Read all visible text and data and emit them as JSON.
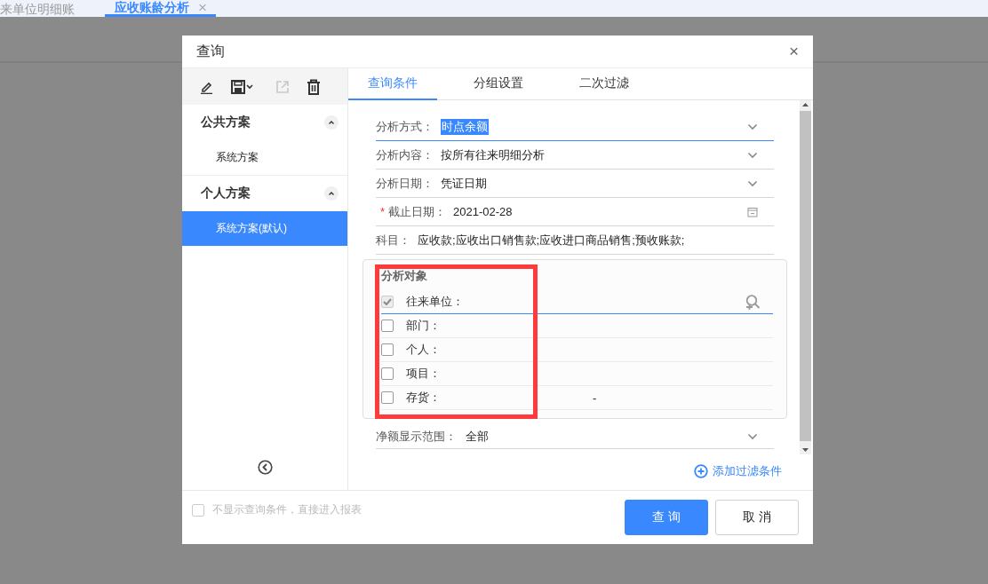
{
  "page_tabs": [
    {
      "label": "来单位明细账",
      "selected": false,
      "closable": false
    },
    {
      "label": "应收账龄分析",
      "selected": true,
      "closable": true,
      "close": "×"
    }
  ],
  "dialog": {
    "title": "查询",
    "close": "×"
  },
  "toolbar": [
    {
      "kind": "edit",
      "disabled": false
    },
    {
      "kind": "save",
      "disabled": false
    },
    {
      "kind": "export",
      "disabled": true
    },
    {
      "kind": "delete",
      "disabled": false
    }
  ],
  "scheme_groups": [
    {
      "title": "公共方案",
      "expanded": true,
      "items": [
        {
          "label": "系统方案",
          "selected": false
        }
      ]
    },
    {
      "title": "个人方案",
      "expanded": true,
      "items": [
        {
          "label": "系统方案(默认)",
          "selected": true
        }
      ]
    }
  ],
  "tabs": [
    {
      "label": "查询条件",
      "selected": true
    },
    {
      "label": "分组设置",
      "selected": false
    },
    {
      "label": "二次过滤",
      "selected": false
    }
  ],
  "fields": [
    {
      "kind": "select",
      "label": "分析方式：",
      "value": "时点余额",
      "required": false,
      "focused": true
    },
    {
      "kind": "select",
      "label": "分析内容：",
      "value": "按所有往来明细分析",
      "required": false,
      "focused": false
    },
    {
      "kind": "select",
      "label": "分析日期：",
      "value": "凭证日期",
      "required": false,
      "focused": false
    },
    {
      "kind": "date",
      "required_mark": "*",
      "label": "截止日期：",
      "value": "2021-02-28",
      "required": true,
      "focused": false
    },
    {
      "kind": "text",
      "label": "科目：",
      "value": "应收款;应收出口销售款;应收进口商品销售;预收账款;",
      "required": false,
      "focused": false
    }
  ],
  "analysis_objects": {
    "title": "分析对象",
    "highlighted": true,
    "rows": [
      {
        "label": "往来单位：",
        "value": "",
        "checked": true,
        "disabled": true,
        "focused": true,
        "lookup": true
      },
      {
        "label": "部门：",
        "value": "",
        "checked": false,
        "disabled": false,
        "focused": false,
        "lookup": false
      },
      {
        "label": "个人：",
        "value": "",
        "checked": false,
        "disabled": false,
        "focused": false,
        "lookup": false
      },
      {
        "label": "项目：",
        "value": "",
        "checked": false,
        "disabled": false,
        "focused": false,
        "lookup": false
      },
      {
        "label": "存货：",
        "value": "-",
        "checked": false,
        "disabled": false,
        "focused": false,
        "lookup": false
      }
    ]
  },
  "net_range": {
    "kind": "select",
    "label": "净额显示范围：",
    "value": "全部"
  },
  "add_filter": "添加过滤条件",
  "skip_option": {
    "label": "不显示查询条件，直接进入报表",
    "checked": false
  },
  "buttons": [
    {
      "label": "查 询",
      "kind": "primary"
    },
    {
      "label": "取 消",
      "kind": "default"
    }
  ]
}
